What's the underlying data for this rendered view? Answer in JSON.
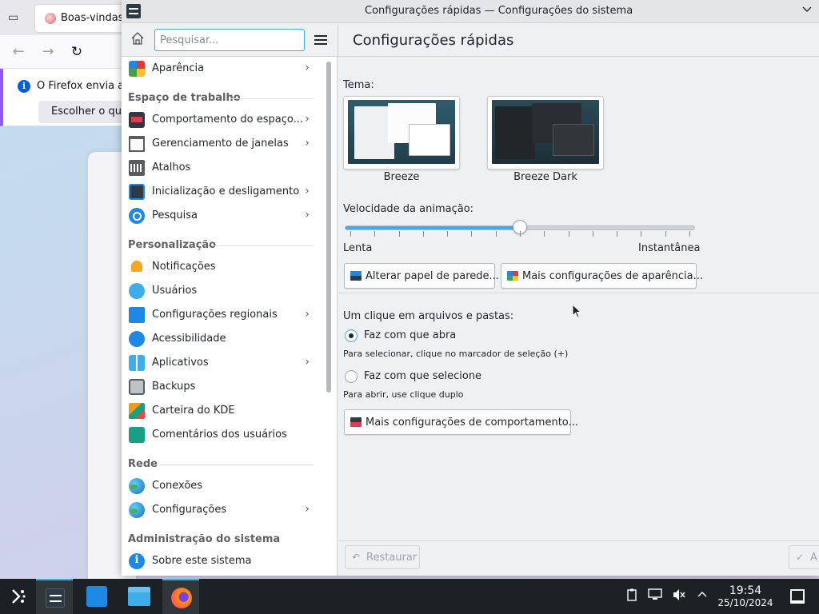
{
  "firefox": {
    "tab_title": "Boas-vindas",
    "notice_text": "O Firefox envia al",
    "notice_button": "Escolher o que"
  },
  "window": {
    "title": "Configurações rápidas — Configurações do sistema",
    "menu_icon": "chevron-down-icon"
  },
  "search": {
    "placeholder": "Pesquisar..."
  },
  "sidebar": {
    "top_item": {
      "label": "Aparência",
      "icon": "appearance-icon",
      "has_arrow": true
    },
    "categories": [
      {
        "title": "Espaço de trabalho",
        "items": [
          {
            "label": "Comportamento do espaço...",
            "icon": "workspace-behavior-icon",
            "has_arrow": true
          },
          {
            "label": "Gerenciamento de janelas",
            "icon": "window-management-icon",
            "has_arrow": true
          },
          {
            "label": "Atalhos",
            "icon": "shortcuts-icon",
            "has_arrow": false
          },
          {
            "label": "Inicialização e desligamento",
            "icon": "startup-shutdown-icon",
            "has_arrow": true
          },
          {
            "label": "Pesquisa",
            "icon": "search-icon",
            "has_arrow": true
          }
        ]
      },
      {
        "title": "Personalização",
        "items": [
          {
            "label": "Notificações",
            "icon": "bell-icon",
            "has_arrow": false
          },
          {
            "label": "Usuários",
            "icon": "users-icon",
            "has_arrow": false
          },
          {
            "label": "Configurações regionais",
            "icon": "regional-icon",
            "has_arrow": true
          },
          {
            "label": "Acessibilidade",
            "icon": "accessibility-icon",
            "has_arrow": false
          },
          {
            "label": "Aplicativos",
            "icon": "applications-icon",
            "has_arrow": true
          },
          {
            "label": "Backups",
            "icon": "backups-icon",
            "has_arrow": false
          },
          {
            "label": "Carteira do KDE",
            "icon": "wallet-icon",
            "has_arrow": false
          },
          {
            "label": "Comentários dos usuários",
            "icon": "feedback-icon",
            "has_arrow": false
          }
        ]
      },
      {
        "title": "Rede",
        "items": [
          {
            "label": "Conexões",
            "icon": "globe-icon",
            "has_arrow": false
          },
          {
            "label": "Configurações",
            "icon": "globe-settings-icon",
            "has_arrow": true
          }
        ]
      },
      {
        "title": "Administração do sistema",
        "items": [
          {
            "label": "Sobre este sistema",
            "icon": "info-icon",
            "has_arrow": false
          }
        ]
      }
    ]
  },
  "page": {
    "title": "Configurações rápidas",
    "theme_label": "Tema:",
    "themes": [
      {
        "name": "Breeze",
        "variant": "light"
      },
      {
        "name": "Breeze Dark",
        "variant": "dark"
      }
    ],
    "animation_label": "Velocidade da animação:",
    "animation_level": 0.5,
    "animation_min_label": "Lenta",
    "animation_max_label": "Instantânea",
    "wallpaper_button": "Alterar papel de parede...",
    "appearance_button": "Mais configurações de aparência...",
    "click_label": "Um clique em arquivos e pastas:",
    "options": [
      {
        "label": "Faz com que abra",
        "hint": "Para selecionar, clique no marcador de seleção (+)",
        "checked": true
      },
      {
        "label": "Faz com que selecione",
        "hint": "Para abrir, use clique duplo",
        "checked": false
      }
    ],
    "behavior_button": "Mais configurações de comportamento...",
    "reset_button": "Restaurar",
    "apply_button": "A"
  },
  "taskbar": {
    "apps": [
      {
        "name": "application-launcher",
        "icon": "kde-launcher-icon",
        "active": false
      },
      {
        "name": "system-settings",
        "icon": "settings-icon",
        "active": true
      },
      {
        "name": "discover",
        "icon": "discover-icon",
        "active": false
      },
      {
        "name": "dolphin",
        "icon": "folder-icon",
        "active": false
      },
      {
        "name": "firefox",
        "icon": "firefox-icon",
        "active": true
      }
    ],
    "tray_icons": [
      "clipboard-icon",
      "network-icon",
      "volume-muted-icon",
      "chevron-up-icon"
    ],
    "time": "19:54",
    "date": "25/10/2024"
  },
  "colors": {
    "accent": "#3daee9",
    "taskbar": "#1c2125",
    "window_bg": "#eff0f1"
  }
}
